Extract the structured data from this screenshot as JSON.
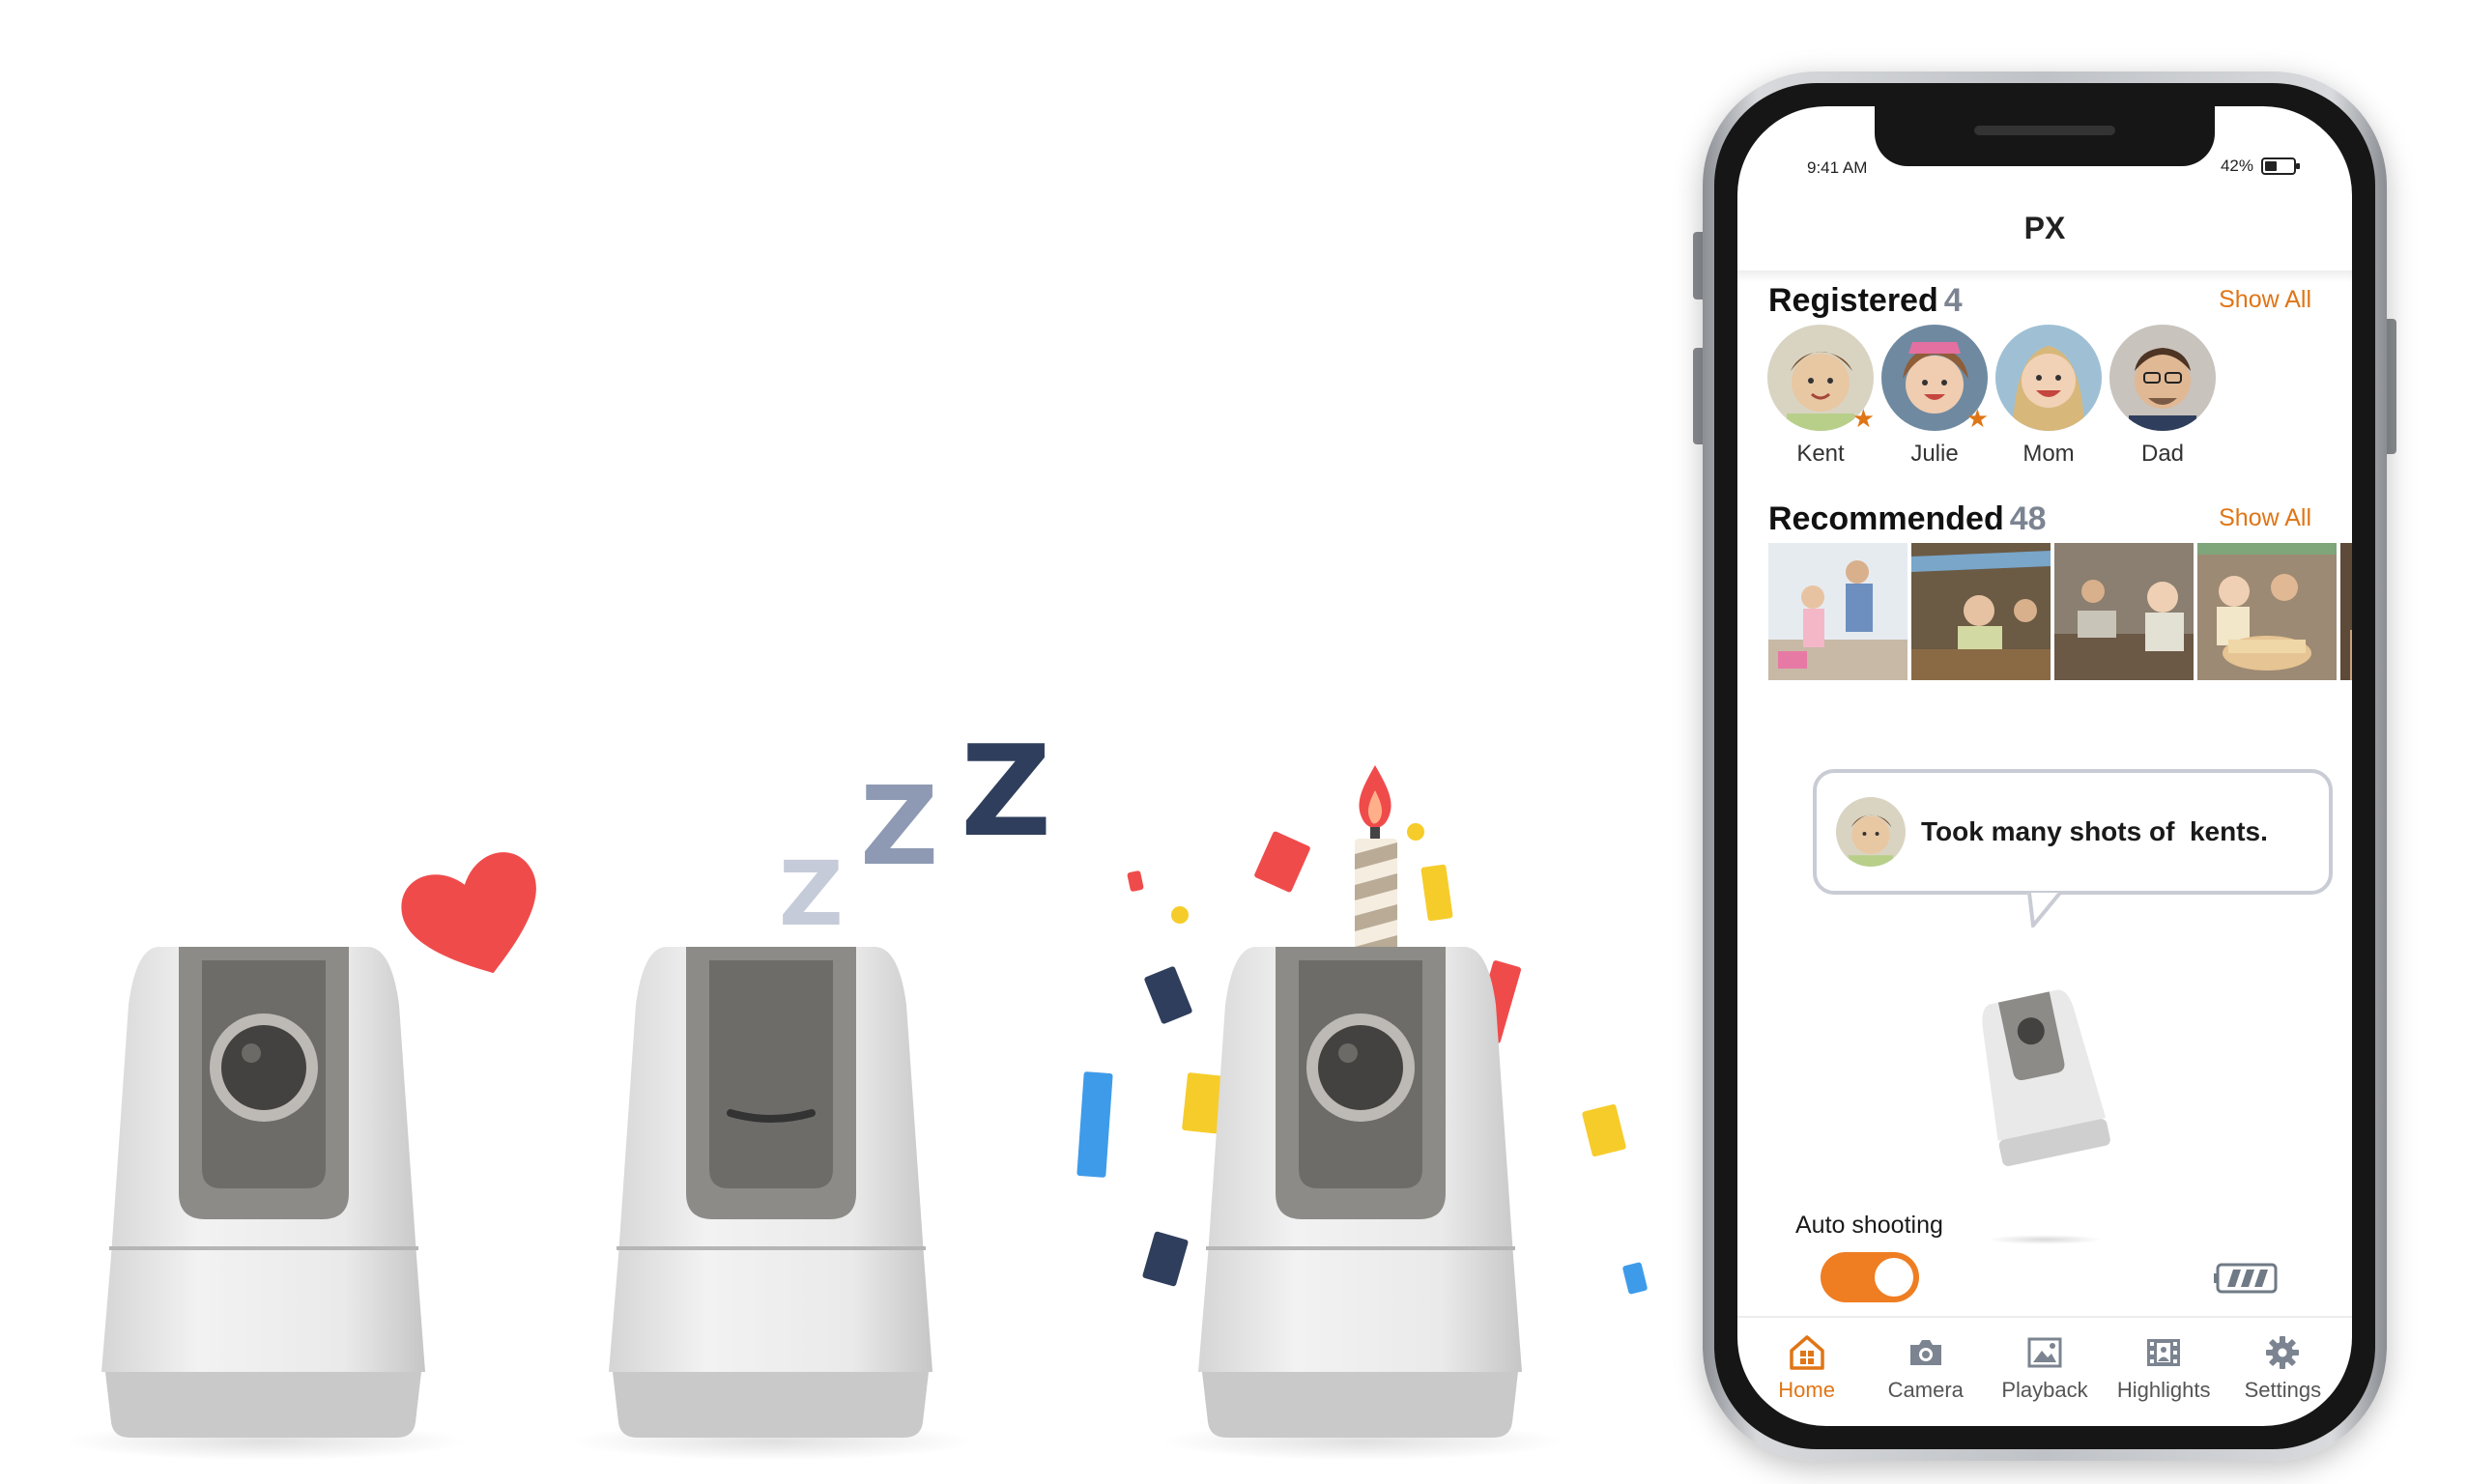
{
  "phone": {
    "status": {
      "time": "9:41 AM",
      "battery": "42%"
    },
    "app_title": "PX",
    "registered": {
      "title": "Registered",
      "count": "4",
      "show_all": "Show All",
      "people": [
        {
          "name": "Kent",
          "starred": true
        },
        {
          "name": "Julie",
          "starred": true
        },
        {
          "name": "Mom",
          "starred": false
        },
        {
          "name": "Dad",
          "starred": false
        }
      ]
    },
    "recommended": {
      "title": "Recommended",
      "count": "48",
      "show_all": "Show All"
    },
    "bubble": {
      "text": "Took many shots of  kents."
    },
    "auto_shooting": {
      "label": "Auto shooting",
      "enabled": true
    },
    "tabs": [
      {
        "label": "Home",
        "icon": "home-icon",
        "active": true
      },
      {
        "label": "Camera",
        "icon": "camera-icon",
        "active": false
      },
      {
        "label": "Playback",
        "icon": "playback-icon",
        "active": false
      },
      {
        "label": "Highlights",
        "icon": "highlights-icon",
        "active": false
      },
      {
        "label": "Settings",
        "icon": "gear-icon",
        "active": false
      }
    ]
  },
  "illustration": {
    "sleep_letters": [
      "Z",
      "Z",
      "Z"
    ]
  },
  "colors": {
    "accent": "#e07516",
    "toggle": "#ef7d22",
    "heart": "#f04b4b",
    "z_dark": "#2f3e5c",
    "z_mid": "#8e9ab3",
    "z_light": "#c5cbd8"
  }
}
